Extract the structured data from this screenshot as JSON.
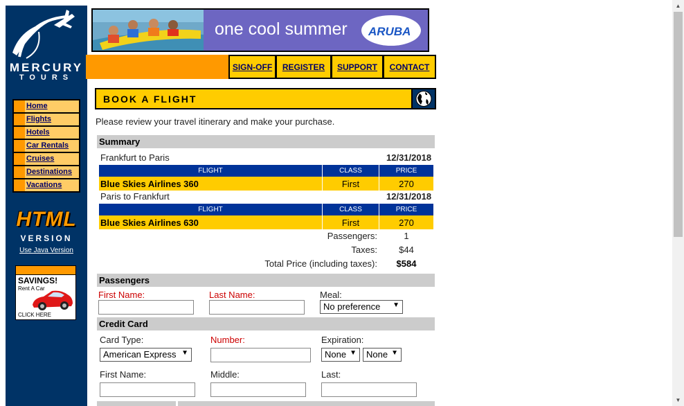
{
  "brand": {
    "name": "MERCURY",
    "sub": "TOURS"
  },
  "sidebar": {
    "items": [
      {
        "label": "Home"
      },
      {
        "label": "Flights"
      },
      {
        "label": "Hotels"
      },
      {
        "label": "Car Rentals"
      },
      {
        "label": "Cruises"
      },
      {
        "label": "Destinations"
      },
      {
        "label": "Vacations"
      }
    ],
    "html_logo": "HTML",
    "version_word": "VERSION",
    "java_link": "Use Java Version",
    "ad": {
      "headline": "SAVINGS!",
      "sub": "Rent A Car",
      "cta": "CLICK HERE"
    }
  },
  "banner": {
    "text": "one cool summer",
    "logo": "ARUBA"
  },
  "topnav": [
    {
      "label": "SIGN-OFF"
    },
    {
      "label": "REGISTER"
    },
    {
      "label": "SUPPORT"
    },
    {
      "label": "CONTACT"
    }
  ],
  "page": {
    "title": "BOOK A FLIGHT",
    "intro": "Please review your travel itinerary and make your purchase."
  },
  "summary": {
    "heading": "Summary",
    "columns": {
      "flight": "FLIGHT",
      "class": "CLASS",
      "price": "PRICE"
    },
    "legs": [
      {
        "route": "Frankfurt to Paris",
        "date": "12/31/2018",
        "flight": "Blue Skies Airlines 360",
        "class": "First",
        "price": "270"
      },
      {
        "route": "Paris to Frankfurt",
        "date": "12/31/2018",
        "flight": "Blue Skies Airlines 630",
        "class": "First",
        "price": "270"
      }
    ],
    "passengers_label": "Passengers:",
    "passengers_value": "1",
    "taxes_label": "Taxes:",
    "taxes_value": "$44",
    "total_label": "Total Price (including taxes):",
    "total_value": "$584"
  },
  "passengers": {
    "heading": "Passengers",
    "first_name_label": "First Name:",
    "last_name_label": "Last Name:",
    "meal_label": "Meal:",
    "meal_value": "No preference"
  },
  "credit_card": {
    "heading": "Credit Card",
    "card_type_label": "Card Type:",
    "card_type_value": "American Express",
    "number_label": "Number:",
    "expiration_label": "Expiration:",
    "exp_month_value": "None",
    "exp_year_value": "None",
    "first_name_label": "First Name:",
    "middle_label": "Middle:",
    "last_label": "Last:"
  },
  "colors": {
    "navy": "#003366",
    "orange": "#ff9900",
    "yellow": "#ffcc00",
    "table_header": "#003399",
    "required_red": "#cc0000"
  }
}
